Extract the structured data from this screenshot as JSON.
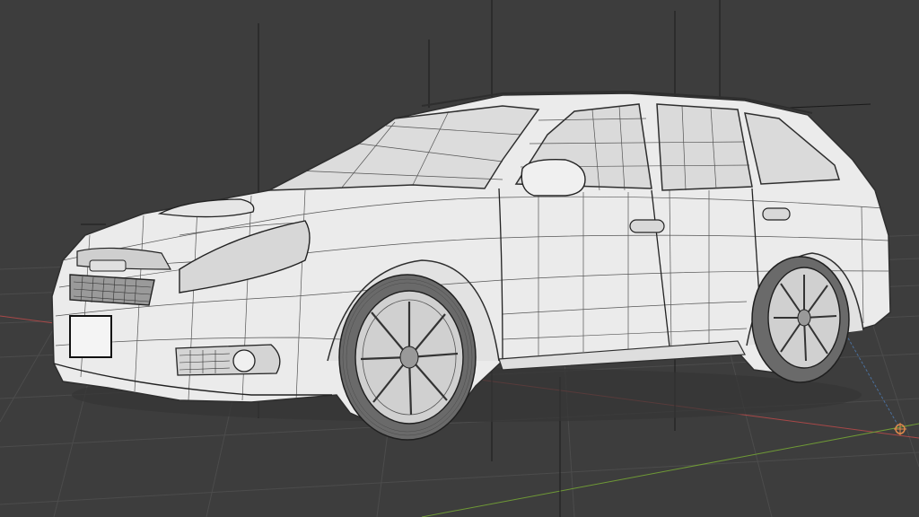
{
  "viewport": {
    "background": "#3d3d3d",
    "grid_color": "#4c4c4c",
    "x_axis_color": "#a84848",
    "y_axis_color": "#6f9a36",
    "vertical_axis_color": "#4a6f9c",
    "reference_line_color": "#1a1a1a",
    "origin_marker_color": "#e08a4c"
  },
  "model": {
    "shading": "wireframe-on-shaded",
    "body_color": "#ebebeb",
    "wire_color": "#3c3c3c",
    "glass_color": "#dcdcdc",
    "tire_color": "#6a6a6a",
    "rim_color": "#d0d0d0"
  }
}
